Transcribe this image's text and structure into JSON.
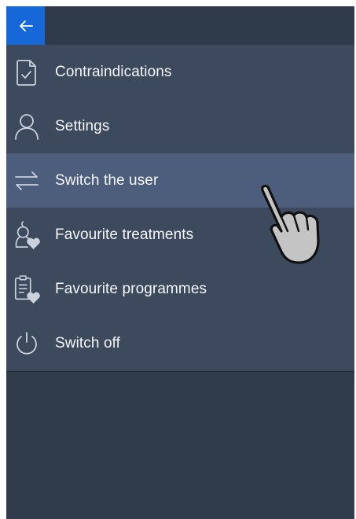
{
  "header": {
    "back_icon": "arrow-left-icon"
  },
  "menu": {
    "items": [
      {
        "label": "Contraindications",
        "icon": "document-check-icon",
        "active": false
      },
      {
        "label": "Settings",
        "icon": "user-icon",
        "active": false
      },
      {
        "label": "Switch the user",
        "icon": "switch-arrows-icon",
        "active": true
      },
      {
        "label": "Favourite treatments",
        "icon": "treatment-heart-icon",
        "active": false
      },
      {
        "label": "Favourite programmes",
        "icon": "clipboard-heart-icon",
        "active": false
      },
      {
        "label": "Switch off",
        "icon": "power-icon",
        "active": false
      }
    ]
  },
  "colors": {
    "accent": "#1668d8",
    "menu_bg": "#3d4a5e",
    "active_bg": "#4d5e7c",
    "page_bg": "#303b4b",
    "text": "#f4f6fa",
    "icon": "#c9d1dd"
  }
}
